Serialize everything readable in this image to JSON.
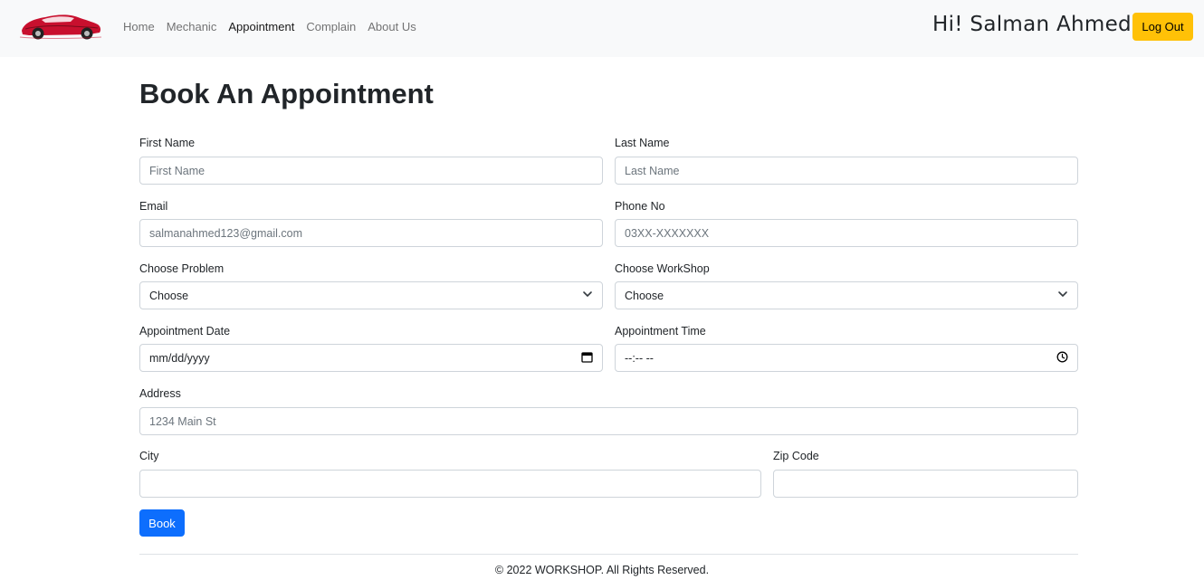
{
  "nav": {
    "logo_icon": "sports-car-logo",
    "links": [
      "Home",
      "Mechanic",
      "Appointment",
      "Complain",
      "About Us"
    ],
    "active_link": "Appointment",
    "greeting": "Hi! Salman Ahmed",
    "logout_label": "Log Out"
  },
  "page": {
    "title": "Book An Appointment"
  },
  "form": {
    "first_name": {
      "label": "First Name",
      "placeholder": "First Name"
    },
    "last_name": {
      "label": "Last Name",
      "placeholder": "Last Name"
    },
    "email": {
      "label": "Email",
      "placeholder": "salmanahmed123@gmail.com"
    },
    "phone": {
      "label": "Phone No",
      "placeholder": "03XX-XXXXXXX"
    },
    "problem": {
      "label": "Choose Problem",
      "selected": "Choose"
    },
    "workshop": {
      "label": "Choose WorkShop",
      "selected": "Choose"
    },
    "date": {
      "label": "Appointment Date",
      "value": "mm/dd/yyyy"
    },
    "time": {
      "label": "Appointment Time",
      "value": "--:-- --"
    },
    "address": {
      "label": "Address",
      "placeholder": "1234 Main St"
    },
    "city": {
      "label": "City",
      "placeholder": ""
    },
    "zip": {
      "label": "Zip Code",
      "placeholder": ""
    },
    "submit_label": "Book"
  },
  "footer": {
    "text": "© 2022 WORKSHOP. All Rights Reserved."
  },
  "colors": {
    "navbar_bg": "#f8f9fa",
    "logout_bg": "#ffc107",
    "primary": "#0d6efd",
    "logo_red": "#c8102e"
  }
}
